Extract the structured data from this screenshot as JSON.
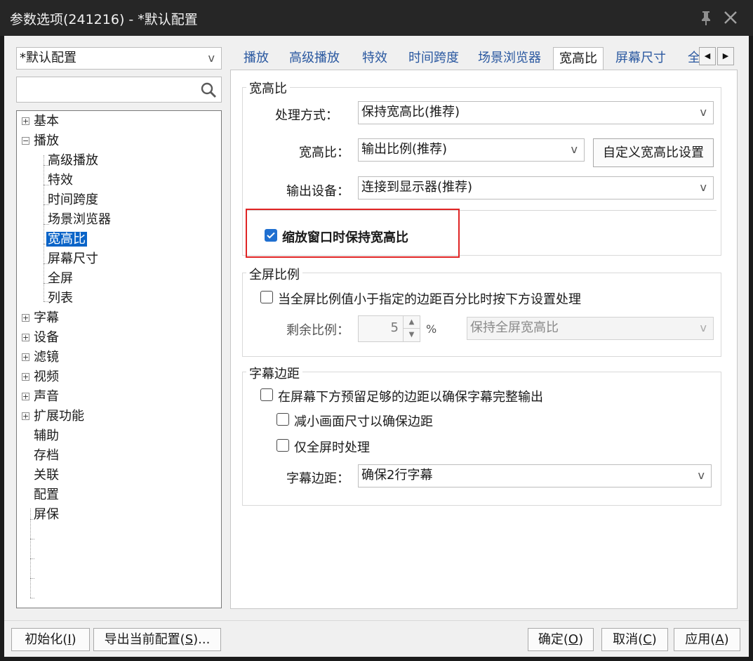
{
  "window": {
    "title": "参数选项(241216) - *默认配置",
    "pin_icon": "pin-icon",
    "close_icon": "close-icon"
  },
  "profile_select": {
    "value": "*默认配置"
  },
  "search": {
    "placeholder": ""
  },
  "tree": {
    "items": [
      {
        "label": "基本",
        "expander": "+"
      },
      {
        "label": "播放",
        "expander": "−"
      },
      {
        "label": "高级播放"
      },
      {
        "label": "特效"
      },
      {
        "label": "时间跨度"
      },
      {
        "label": "场景浏览器"
      },
      {
        "label": "宽高比",
        "selected": true
      },
      {
        "label": "屏幕尺寸"
      },
      {
        "label": "全屏"
      },
      {
        "label": "列表"
      },
      {
        "label": "字幕",
        "expander": "+"
      },
      {
        "label": "设备",
        "expander": "+"
      },
      {
        "label": "滤镜",
        "expander": "+"
      },
      {
        "label": "视频",
        "expander": "+"
      },
      {
        "label": "声音",
        "expander": "+"
      },
      {
        "label": "扩展功能",
        "expander": "+"
      },
      {
        "label": "辅助"
      },
      {
        "label": "存档"
      },
      {
        "label": "关联"
      },
      {
        "label": "配置"
      },
      {
        "label": "屏保"
      }
    ]
  },
  "tabs": [
    "播放",
    "高级播放",
    "特效",
    "时间跨度",
    "场景浏览器",
    "宽高比",
    "屏幕尺寸",
    "全"
  ],
  "tab_active": "宽高比",
  "aspect_group": {
    "title": "宽高比",
    "process_label": "处理方式：",
    "process_value": "保持宽高比(推荐)",
    "ratio_label": "宽高比：",
    "ratio_value": "输出比例(推荐)",
    "custom_button": "自定义宽高比设置",
    "device_label": "输出设备：",
    "device_value": "连接到显示器(推荐)",
    "keep_on_resize": "缩放窗口时保持宽高比",
    "keep_on_resize_checked": true
  },
  "fullscreen_group": {
    "title": "全屏比例",
    "margin_check": "当全屏比例值小于指定的边距百分比时按下方设置处理",
    "margin_checked": false,
    "remain_label": "剩余比例：",
    "remain_value": "5",
    "percent": "%",
    "keep_value": "保持全屏宽高比"
  },
  "subtitle_group": {
    "title": "字幕边距",
    "reserve_check": "在屏幕下方预留足够的边距以确保字幕完整输出",
    "reduce_check": "减小画面尺寸以确保边距",
    "fullscreen_only_check": "仅全屏时处理",
    "margin_label": "字幕边距：",
    "margin_value": "确保2行字幕"
  },
  "footer": {
    "init_text": "初始化(",
    "init_key": "I",
    "export_text": "导出当前配置(",
    "export_key": "S",
    "export_tail": ")...",
    "ok_text": "确定(",
    "ok_key": "O",
    "cancel_text": "取消(",
    "cancel_key": "C",
    "apply_text": "应用(",
    "apply_key": "A",
    "close_paren": ")"
  }
}
